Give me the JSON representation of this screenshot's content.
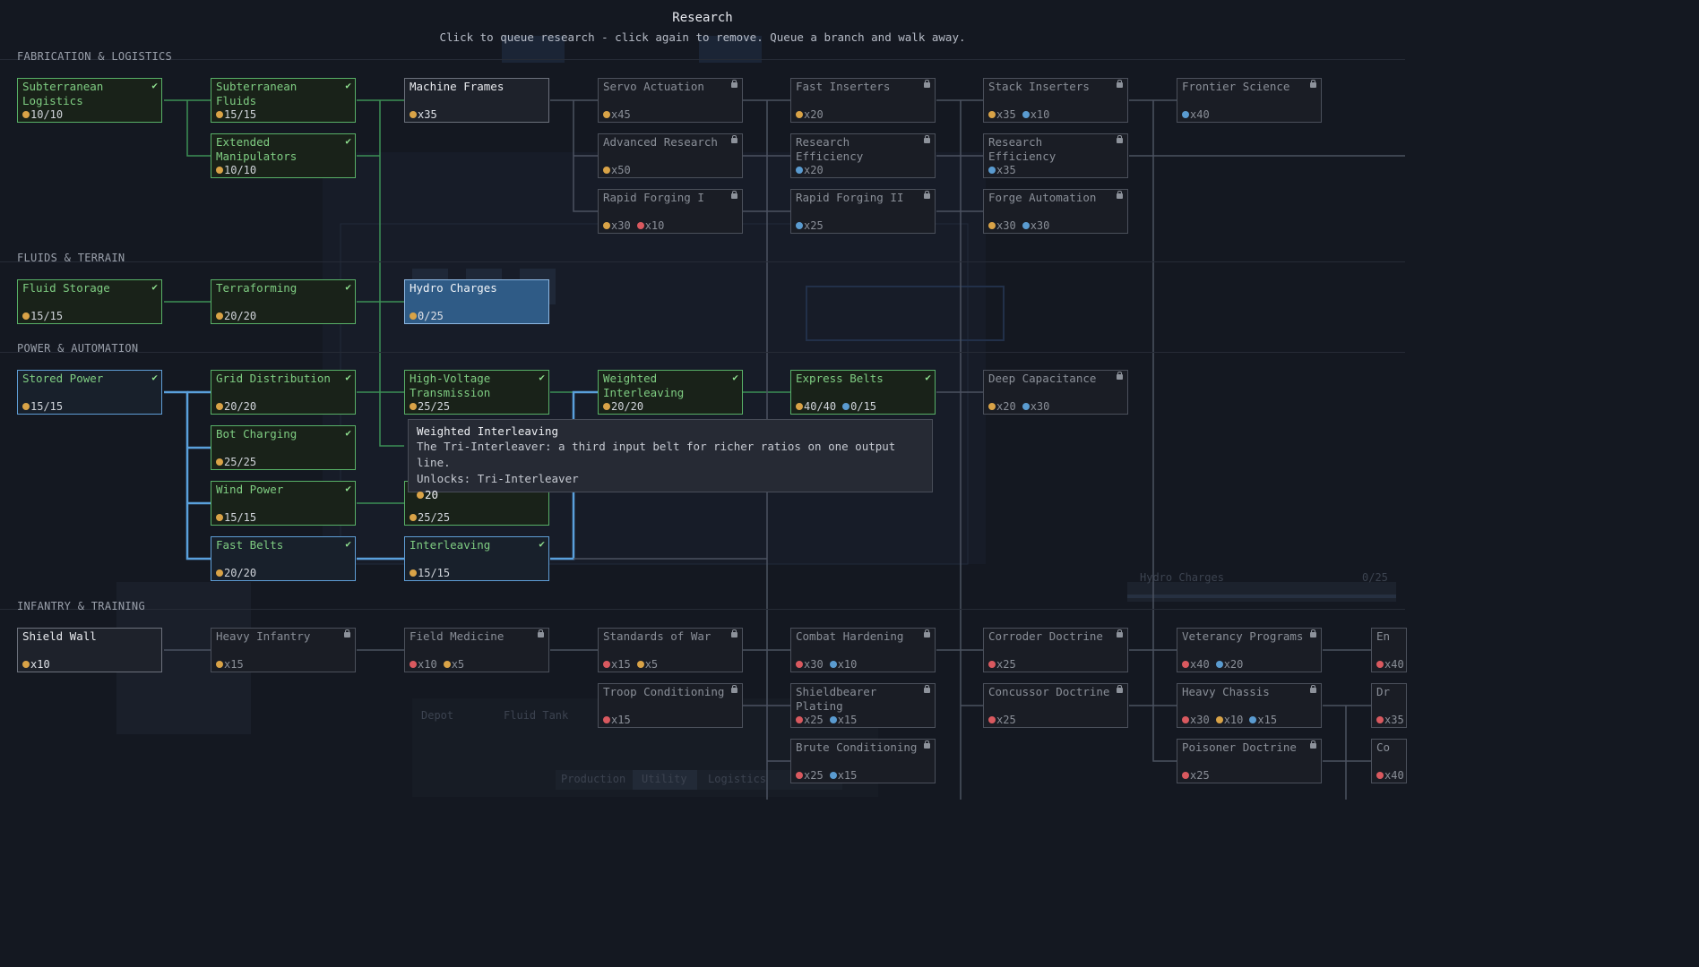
{
  "header": {
    "title": "Research",
    "subtitle": "Click to queue research - click again to remove. Queue a branch and walk away."
  },
  "sections": [
    {
      "label": "FABRICATION & LOGISTICS"
    },
    {
      "label": "FLUIDS & TERRAIN"
    },
    {
      "label": "POWER & AUTOMATION"
    },
    {
      "label": "INFANTRY & TRAINING"
    }
  ],
  "status_colors": {
    "completed": "#58b067",
    "queued": "#2f5b86",
    "locked": "#4b505b",
    "available": "#6c717c"
  },
  "resource_colors": {
    "orange": "#d9a347",
    "blue": "#5a9bd0",
    "red": "#d9595f"
  },
  "nodes": [
    {
      "id": "subterranean-logistics",
      "name": "Subterranean\nLogistics",
      "state": "done",
      "costs": [
        {
          "color": "orange",
          "text": "10/10"
        }
      ]
    },
    {
      "id": "subterranean-fluids",
      "name": "Subterranean Fluids",
      "state": "done",
      "costs": [
        {
          "color": "orange",
          "text": "15/15"
        }
      ]
    },
    {
      "id": "extended-manipulators",
      "name": "Extended\nManipulators",
      "state": "done",
      "costs": [
        {
          "color": "orange",
          "text": "10/10"
        }
      ]
    },
    {
      "id": "machine-frames",
      "name": "Machine Frames",
      "state": "avail",
      "costs": [
        {
          "color": "orange",
          "text": "x35"
        }
      ]
    },
    {
      "id": "servo-actuation",
      "name": "Servo Actuation",
      "state": "locked",
      "costs": [
        {
          "color": "orange",
          "text": "x45"
        }
      ]
    },
    {
      "id": "advanced-research",
      "name": "Advanced Research",
      "state": "locked",
      "costs": [
        {
          "color": "orange",
          "text": "x50"
        }
      ]
    },
    {
      "id": "rapid-forging-1",
      "name": "Rapid Forging I",
      "state": "locked",
      "costs": [
        {
          "color": "orange",
          "text": "x30"
        },
        {
          "color": "red",
          "text": "x10"
        }
      ]
    },
    {
      "id": "fast-inserters",
      "name": "Fast Inserters",
      "state": "locked",
      "costs": [
        {
          "color": "orange",
          "text": "x20"
        }
      ]
    },
    {
      "id": "research-efficiency-1",
      "name": "Research Efficiency\nI",
      "state": "locked",
      "costs": [
        {
          "color": "blue",
          "text": "x20"
        }
      ]
    },
    {
      "id": "rapid-forging-2",
      "name": "Rapid Forging II",
      "state": "locked",
      "costs": [
        {
          "color": "blue",
          "text": "x25"
        }
      ]
    },
    {
      "id": "stack-inserters",
      "name": "Stack Inserters",
      "state": "locked",
      "costs": [
        {
          "color": "orange",
          "text": "x35"
        },
        {
          "color": "blue",
          "text": "x10"
        }
      ]
    },
    {
      "id": "research-efficiency-2",
      "name": "Research Efficiency\nII",
      "state": "locked",
      "costs": [
        {
          "color": "blue",
          "text": "x35"
        }
      ]
    },
    {
      "id": "forge-automation",
      "name": "Forge Automation",
      "state": "locked",
      "costs": [
        {
          "color": "orange",
          "text": "x30"
        },
        {
          "color": "blue",
          "text": "x30"
        }
      ]
    },
    {
      "id": "frontier-science",
      "name": "Frontier Science",
      "state": "locked",
      "costs": [
        {
          "color": "blue",
          "text": "x40"
        }
      ]
    },
    {
      "id": "fluid-storage",
      "name": "Fluid Storage",
      "state": "done",
      "costs": [
        {
          "color": "orange",
          "text": "15/15"
        }
      ]
    },
    {
      "id": "terraforming",
      "name": "Terraforming",
      "state": "done",
      "costs": [
        {
          "color": "orange",
          "text": "20/20"
        }
      ]
    },
    {
      "id": "hydro-charges",
      "name": "Hydro Charges",
      "state": "queued",
      "costs": [
        {
          "color": "orange",
          "text": "0/25"
        }
      ]
    },
    {
      "id": "stored-power",
      "name": "Stored Power",
      "state": "done",
      "blue": true,
      "costs": [
        {
          "color": "orange",
          "text": "15/15"
        }
      ]
    },
    {
      "id": "grid-distribution",
      "name": "Grid Distribution",
      "state": "done",
      "costs": [
        {
          "color": "orange",
          "text": "20/20"
        }
      ]
    },
    {
      "id": "high-voltage-transmission",
      "name": "High-Voltage\nTransmission",
      "state": "done",
      "costs": [
        {
          "color": "orange",
          "text": "25/25"
        }
      ]
    },
    {
      "id": "weighted-interleaving",
      "name": "Weighted\nInterleaving",
      "state": "done",
      "costs": [
        {
          "color": "orange",
          "text": "20/20"
        }
      ]
    },
    {
      "id": "express-belts",
      "name": "Express Belts",
      "state": "done",
      "costs": [
        {
          "color": "orange",
          "text": "40/40"
        },
        {
          "color": "blue",
          "text": "0/15"
        }
      ]
    },
    {
      "id": "deep-capacitance",
      "name": "Deep Capacitance",
      "state": "locked",
      "costs": [
        {
          "color": "orange",
          "text": "x20"
        },
        {
          "color": "blue",
          "text": "x30"
        }
      ]
    },
    {
      "id": "bot-charging",
      "name": "Bot Charging",
      "state": "done",
      "costs": [
        {
          "color": "orange",
          "text": "25/25"
        }
      ]
    },
    {
      "id": "wind-power",
      "name": "Wind Power",
      "state": "done",
      "costs": [
        {
          "color": "orange",
          "text": "15/15"
        }
      ]
    },
    {
      "id": "tidal-power",
      "name": "",
      "state": "done",
      "costs": [
        {
          "color": "orange",
          "text": "25/25"
        }
      ]
    },
    {
      "id": "fast-belts",
      "name": "Fast Belts",
      "state": "done",
      "blue": true,
      "costs": [
        {
          "color": "orange",
          "text": "20/20"
        }
      ]
    },
    {
      "id": "interleaving",
      "name": "Interleaving",
      "state": "done",
      "blue": true,
      "costs": [
        {
          "color": "orange",
          "text": "15/15"
        }
      ]
    },
    {
      "id": "shield-wall",
      "name": "Shield Wall",
      "state": "avail",
      "costs": [
        {
          "color": "orange",
          "text": "x10"
        }
      ]
    },
    {
      "id": "heavy-infantry",
      "name": "Heavy Infantry",
      "state": "locked",
      "costs": [
        {
          "color": "orange",
          "text": "x15"
        }
      ]
    },
    {
      "id": "field-medicine",
      "name": "Field Medicine",
      "state": "locked",
      "costs": [
        {
          "color": "red",
          "text": "x10"
        },
        {
          "color": "orange",
          "text": "x5"
        }
      ]
    },
    {
      "id": "standards-of-war",
      "name": "Standards of War",
      "state": "locked",
      "costs": [
        {
          "color": "red",
          "text": "x15"
        },
        {
          "color": "orange",
          "text": "x5"
        }
      ]
    },
    {
      "id": "troop-conditioning",
      "name": "Troop Conditioning",
      "state": "locked",
      "costs": [
        {
          "color": "red",
          "text": "x15"
        }
      ]
    },
    {
      "id": "combat-hardening",
      "name": "Combat Hardening",
      "state": "locked",
      "costs": [
        {
          "color": "red",
          "text": "x30"
        },
        {
          "color": "blue",
          "text": "x10"
        }
      ]
    },
    {
      "id": "shieldbearer-plating",
      "name": "Shieldbearer Plating",
      "state": "locked",
      "costs": [
        {
          "color": "red",
          "text": "x25"
        },
        {
          "color": "blue",
          "text": "x15"
        }
      ]
    },
    {
      "id": "brute-conditioning",
      "name": "Brute Conditioning",
      "state": "locked",
      "costs": [
        {
          "color": "red",
          "text": "x25"
        },
        {
          "color": "blue",
          "text": "x15"
        }
      ]
    },
    {
      "id": "corroder-doctrine",
      "name": "Corroder Doctrine",
      "state": "locked",
      "costs": [
        {
          "color": "red",
          "text": "x25"
        }
      ]
    },
    {
      "id": "concussor-doctrine",
      "name": "Concussor Doctrine",
      "state": "locked",
      "costs": [
        {
          "color": "red",
          "text": "x25"
        }
      ]
    },
    {
      "id": "veterancy-programs",
      "name": "Veterancy Programs",
      "state": "locked",
      "costs": [
        {
          "color": "red",
          "text": "x40"
        },
        {
          "color": "blue",
          "text": "x20"
        }
      ]
    },
    {
      "id": "heavy-chassis",
      "name": "Heavy Chassis",
      "state": "locked",
      "costs": [
        {
          "color": "red",
          "text": "x30"
        },
        {
          "color": "orange",
          "text": "x10"
        },
        {
          "color": "blue",
          "text": "x15"
        }
      ]
    },
    {
      "id": "poisoner-doctrine",
      "name": "Poisoner Doctrine",
      "state": "locked",
      "costs": [
        {
          "color": "red",
          "text": "x25"
        }
      ]
    },
    {
      "id": "endu-partial",
      "name": "Endu",
      "state": "locked",
      "nolock": true,
      "costs": [
        {
          "color": "red",
          "text": "x40"
        }
      ]
    },
    {
      "id": "drea-partial",
      "name": "Drea",
      "state": "locked",
      "nolock": true,
      "costs": [
        {
          "color": "red",
          "text": "x35"
        }
      ]
    },
    {
      "id": "colo-partial",
      "name": "Colo",
      "state": "locked",
      "nolock": true,
      "costs": [
        {
          "color": "red",
          "text": "x40"
        }
      ]
    }
  ],
  "tooltip": {
    "title": "Weighted Interleaving",
    "description": "The Tri-Interleaver: a third input belt for richer ratios on one output line.",
    "unlocks": "Unlocks: Tri-Interleaver",
    "cost": "20",
    "cost_color": "orange"
  },
  "background_labels": {
    "hydro_queue": "Hydro Charges",
    "hydro_progress": "0/25",
    "tabs": [
      "Production",
      "Utility",
      "Logistics"
    ],
    "depot": "Depot",
    "fluid_tank": "Fluid Tank"
  }
}
